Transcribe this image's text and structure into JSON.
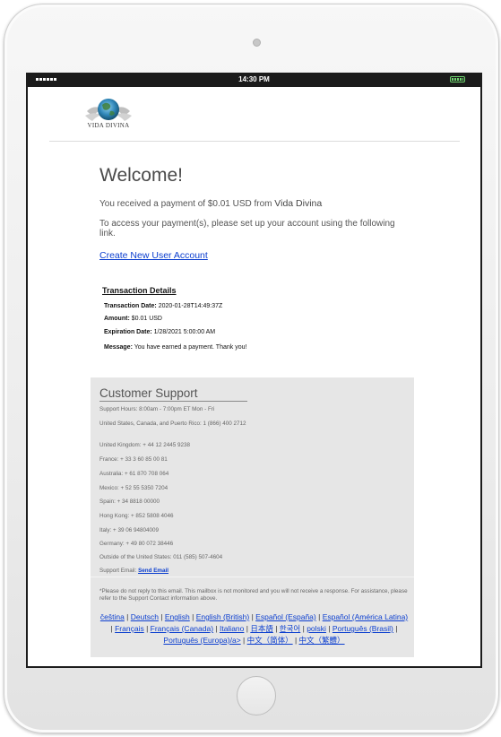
{
  "status_bar": {
    "time": "14:30 PM"
  },
  "logo": {
    "text": "VIDA DIVINA"
  },
  "email": {
    "heading": "Welcome!",
    "payment_text": "You received a payment of $0.01 USD from",
    "company": "Vida Divina",
    "setup_text": "To access your payment(s), please set up your account using the following link.",
    "create_link": "Create New User Account"
  },
  "transaction": {
    "title": "Transaction Details",
    "rows": [
      {
        "label": "Transaction Date:",
        "value": "2020-01-28T14:49:37Z"
      },
      {
        "label": "Amount:",
        "value": "$0.01 USD"
      },
      {
        "label": "Expiration Date:",
        "value": "1/28/2021 5:00:00 AM"
      },
      {
        "label": "Message:",
        "value": "You have earned a payment. Thank you!"
      }
    ]
  },
  "support": {
    "title": "Customer Support",
    "hours": "Support Hours: 8:00am - 7:00pm ET Mon - Fri",
    "phones": [
      "United States, Canada, and Puerto Rico: 1 (866) 400 2712",
      "United Kingdom: + 44 12 2445 9238",
      "France: + 33 3 60 85 00 81",
      "Australia: + 61 870 708 064",
      "Mexico: + 52 55 5350 7204",
      "Spain: + 34 8818 00000",
      "Hong Kong: + 852 5808 4046",
      "Italy: + 39 06 94804009",
      "Germany: + 49 80 072 38446",
      "Outside of the United States: 011 (585) 507-4604"
    ],
    "email_label": "Support Email:",
    "email_link": "Send Email",
    "note": "*Please do not reply to this email. This mailbox is not monitored and you will not receive a response. For assistance, please refer to the Support Contact information above.",
    "languages": [
      "čeština",
      "Deutsch",
      "English",
      "English (British)",
      "Español (España)",
      "Español (América Latina)",
      "Français",
      "Français (Canada)",
      "Italiano",
      "日本語",
      "한국어",
      "polski",
      "Português (Brasil)",
      "Português (Europa)/a>",
      "中文（简体）",
      "中文（繁體）"
    ]
  }
}
